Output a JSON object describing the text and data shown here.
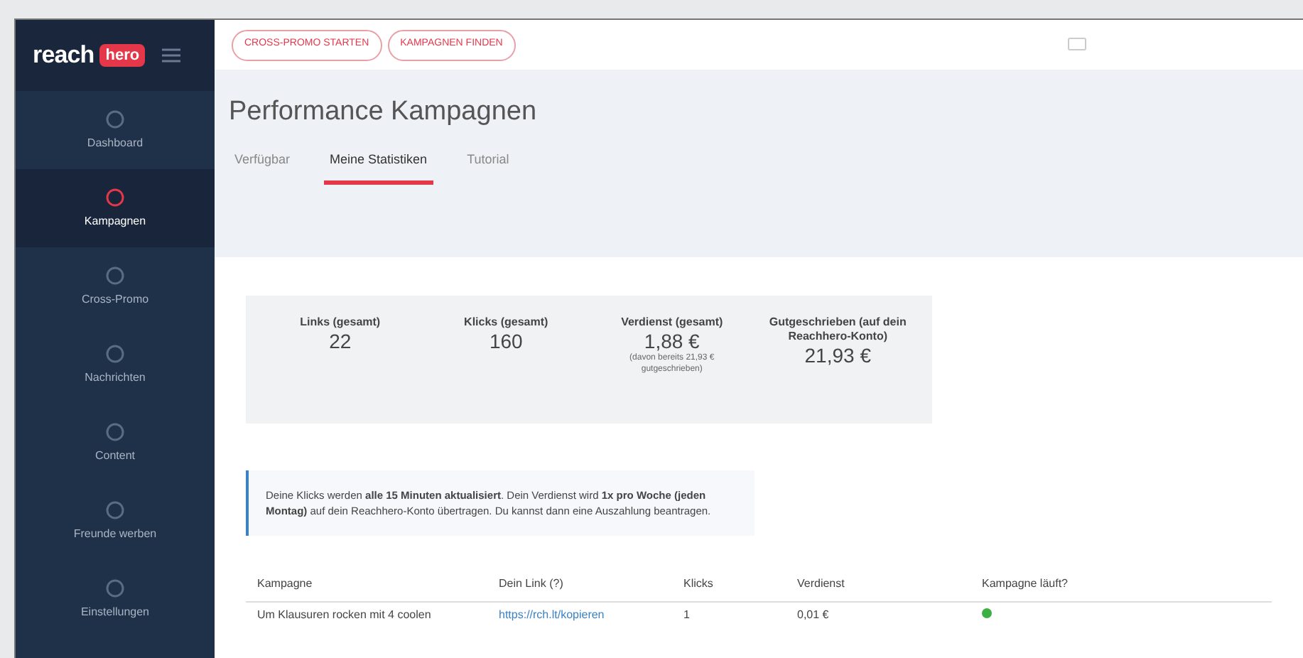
{
  "logo": {
    "text_main": "reach",
    "text_accent": "hero"
  },
  "header": {
    "buttons": [
      "CROSS-PROMO STARTEN",
      "KAMPAGNEN FINDEN"
    ]
  },
  "sidebar": {
    "items": [
      {
        "label": "Dashboard",
        "selected": false
      },
      {
        "label": "Kampagnen",
        "selected": true
      },
      {
        "label": "Cross-Promo",
        "selected": false
      },
      {
        "label": "Nachrichten",
        "selected": false
      },
      {
        "label": "Content",
        "selected": false
      },
      {
        "label": "Freunde werben",
        "selected": false
      },
      {
        "label": "Einstellungen",
        "selected": false
      }
    ]
  },
  "page": {
    "title": "Performance Kampagnen",
    "tabs": [
      {
        "label": "Verfügbar",
        "selected": false
      },
      {
        "label": "Meine Statistiken",
        "selected": true
      },
      {
        "label": "Tutorial",
        "selected": false
      }
    ]
  },
  "stats": [
    {
      "label": "Links (gesamt)",
      "value": "22"
    },
    {
      "label": "Klicks (gesamt)",
      "value": "160"
    },
    {
      "label": "Verdienst (gesamt)",
      "value": "1,88 €",
      "note": "(davon bereits 21,93 € gutgeschrieben)"
    },
    {
      "label": "Gutgeschrieben (auf dein Reachhero-Konto)",
      "value": "21,93 €"
    }
  ],
  "info": "Deine Klicks werden **alle 15 Minuten aktualisiert**. Dein Verdienst wird **1x pro Woche (jeden Montag)** auf dein Reachhero-Konto übertragen. Du kannst dann eine Auszahlung beantragen.",
  "table": {
    "columns": [
      "Kampagne",
      "Dein Link (?)",
      "Klicks",
      "Verdienst",
      "Kampagne läuft?"
    ],
    "rows": [
      {
        "kampagne": "Um Klausuren rocken mit 4 coolen",
        "link": "https://rch.lt/kopieren",
        "klicks": "1",
        "verdienst": "0,01 €",
        "running": true
      }
    ]
  }
}
